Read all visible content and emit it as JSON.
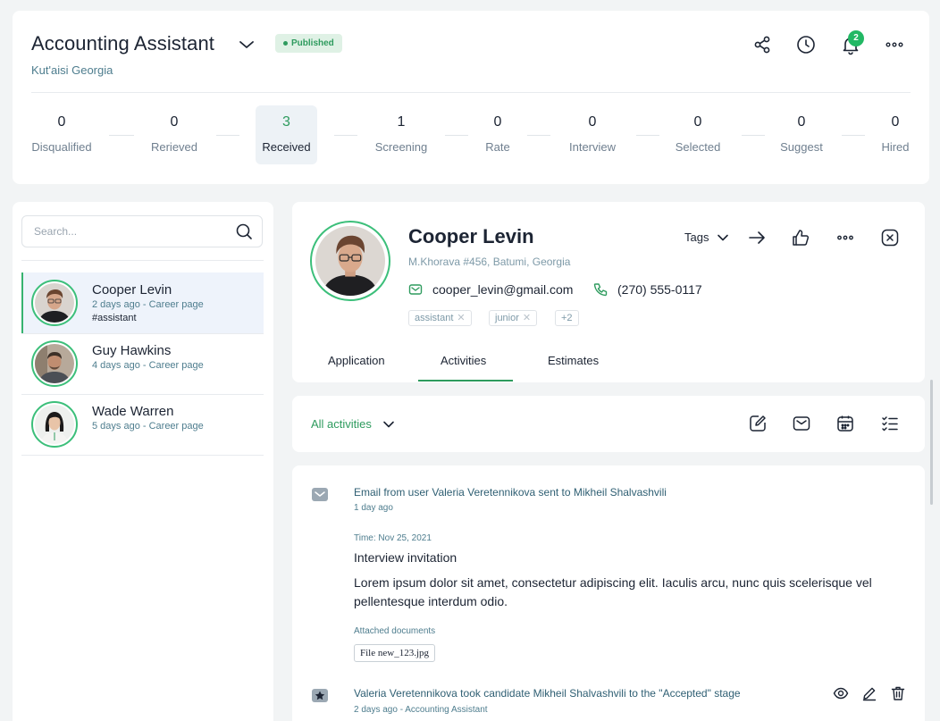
{
  "header": {
    "job_title": "Accounting Assistant",
    "status": "Published",
    "location": "Kut'aisi Georgia",
    "notification_count": "2"
  },
  "stages": [
    {
      "count": "0",
      "label": "Disqualified"
    },
    {
      "count": "0",
      "label": "Rerieved"
    },
    {
      "count": "3",
      "label": "Received"
    },
    {
      "count": "1",
      "label": "Screening"
    },
    {
      "count": "0",
      "label": "Rate"
    },
    {
      "count": "0",
      "label": "Interview"
    },
    {
      "count": "0",
      "label": "Selected"
    },
    {
      "count": "0",
      "label": "Suggest"
    },
    {
      "count": "0",
      "label": "Hired"
    }
  ],
  "search": {
    "placeholder": "Search..."
  },
  "candidates": [
    {
      "name": "Cooper Levin",
      "meta": "2 days ago - Career page",
      "tag": "#assistant"
    },
    {
      "name": "Guy Hawkins",
      "meta": "4 days ago - Career page"
    },
    {
      "name": "Wade Warren",
      "meta": "5 days ago - Career page"
    }
  ],
  "profile": {
    "name": "Cooper Levin",
    "address": "M.Khorava #456, Batumi, Georgia",
    "email": "cooper_levin@gmail.com",
    "phone": "(270) 555-0117",
    "tags": [
      "assistant",
      "junior"
    ],
    "more_tags": "+2",
    "tags_label": "Tags",
    "tabs": [
      "Application",
      "Activities",
      "Estimates"
    ]
  },
  "activities": {
    "filter_label": "All activities",
    "items": [
      {
        "title": "Email from user Valeria Veretennikova sent to Mikheil Shalvashvili",
        "time": "1 day ago",
        "time_label": "Time: Nov 25, 2021",
        "subject": "Interview invitation",
        "body": "Lorem ipsum dolor sit amet, consectetur adipiscing elit. Iaculis arcu, nunc quis scelerisque vel pellentesque interdum odio.",
        "attach_label": "Attached documents",
        "file": "File new_123.jpg"
      },
      {
        "title": "Valeria Veretennikova took candidate Mikheil Shalvashvili to the \"Accepted\" stage",
        "time": "2 days ago - Accounting Assistant"
      }
    ]
  },
  "colors": {
    "accent": "#2e9b5e",
    "badge": "#22b864",
    "muted": "#4e7d8e"
  }
}
